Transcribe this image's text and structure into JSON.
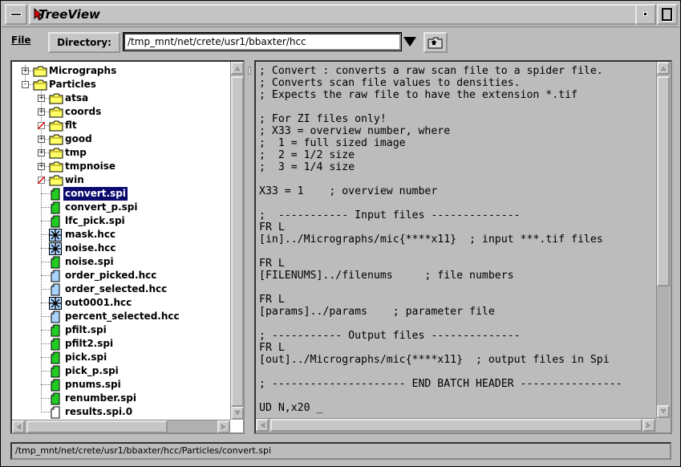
{
  "window": {
    "title": "TreeView"
  },
  "toolbar": {
    "file_label": "File",
    "directory_label": "Directory:",
    "directory_value": "/tmp_mnt/net/crete/usr1/bbaxter/hcc"
  },
  "tree": {
    "items": [
      {
        "label": "Micrographs",
        "type": "folder",
        "level": 0,
        "expander": "+"
      },
      {
        "label": "Particles",
        "type": "folder",
        "level": 0,
        "expander": "-"
      },
      {
        "label": "atsa",
        "type": "folder",
        "level": 1,
        "expander": "+"
      },
      {
        "label": "coords",
        "type": "folder",
        "level": 1,
        "expander": "+"
      },
      {
        "label": "flt",
        "type": "folder",
        "level": 1,
        "expander": "slash"
      },
      {
        "label": "good",
        "type": "folder",
        "level": 1,
        "expander": "+"
      },
      {
        "label": "tmp",
        "type": "folder",
        "level": 1,
        "expander": "+"
      },
      {
        "label": "tmpnoise",
        "type": "folder",
        "level": 1,
        "expander": "+"
      },
      {
        "label": "win",
        "type": "folder",
        "level": 1,
        "expander": "slash"
      },
      {
        "label": "convert.spi",
        "type": "spi",
        "level": 1,
        "selected": true
      },
      {
        "label": "convert_p.spi",
        "type": "spi",
        "level": 1
      },
      {
        "label": "lfc_pick.spi",
        "type": "spi",
        "level": 1
      },
      {
        "label": "mask.hcc",
        "type": "image",
        "level": 1
      },
      {
        "label": "noise.hcc",
        "type": "image",
        "level": 1
      },
      {
        "label": "noise.spi",
        "type": "spi",
        "level": 1
      },
      {
        "label": "order_picked.hcc",
        "type": "doc",
        "level": 1
      },
      {
        "label": "order_selected.hcc",
        "type": "doc",
        "level": 1
      },
      {
        "label": "out0001.hcc",
        "type": "image",
        "level": 1
      },
      {
        "label": "percent_selected.hcc",
        "type": "doc",
        "level": 1
      },
      {
        "label": "pfilt.spi",
        "type": "spi",
        "level": 1
      },
      {
        "label": "pfilt2.spi",
        "type": "spi",
        "level": 1
      },
      {
        "label": "pick.spi",
        "type": "spi",
        "level": 1
      },
      {
        "label": "pick_p.spi",
        "type": "spi",
        "level": 1
      },
      {
        "label": "pnums.spi",
        "type": "spi",
        "level": 1
      },
      {
        "label": "renumber.spi",
        "type": "spi",
        "level": 1
      },
      {
        "label": "results.spi.0",
        "type": "plain",
        "level": 1
      }
    ]
  },
  "editor": {
    "lines": [
      "; Convert : converts a raw scan file to a spider file.",
      "; Converts scan file values to densities.",
      "; Expects the raw file to have the extension *.tif",
      "",
      "; For ZI files only!",
      "; X33 = overview number, where",
      ";  1 = full sized image",
      ";  2 = 1/2 size",
      ";  3 = 1/4 size",
      "",
      "X33 = 1    ; overview number",
      "",
      ";  ----------- Input files --------------",
      "FR L",
      "[in]../Micrographs/mic{****x11}  ; input ***.tif files",
      "",
      "FR L",
      "[FILENUMS]../filenums     ; file numbers",
      "",
      "FR L",
      "[params]../params    ; parameter file",
      "",
      "; ----------- Output files --------------",
      "FR L",
      "[out]../Micrographs/mic{****x11}  ; output files in Spi",
      "",
      "; --------------------- END BATCH HEADER ----------------",
      "",
      "UD N,x20 _"
    ]
  },
  "status": {
    "path": "/tmp_mnt/net/crete/usr1/bbaxter/hcc/Particles/convert.spi"
  },
  "colors": {
    "selection": "#0a0a6e",
    "folder": "#ffff66",
    "spi_file": "#22cc22",
    "doc_file": "#aad4ff"
  }
}
